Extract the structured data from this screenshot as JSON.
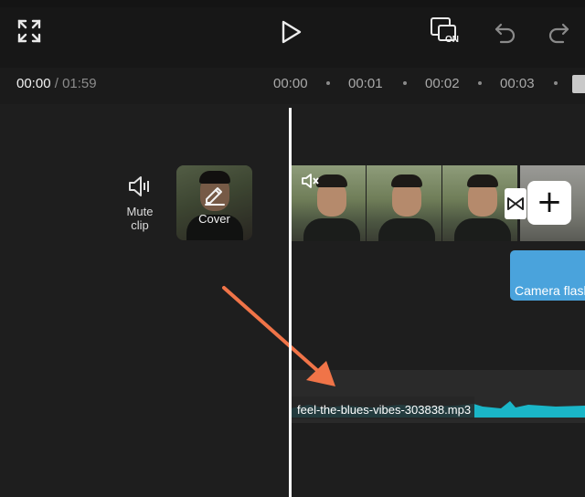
{
  "toolbar": {
    "fullscreen_icon": "expand-icon",
    "play_icon": "play-icon",
    "dual_view_icon": "preview-toggle-icon",
    "dual_view_badge": "ON",
    "undo_icon": "undo-icon",
    "redo_icon": "redo-icon"
  },
  "timecode": {
    "current": "00:00",
    "separator": "/",
    "total": "01:59"
  },
  "ruler": {
    "labels": [
      "00:00",
      "00:01",
      "00:02",
      "00:03"
    ]
  },
  "controls": {
    "mute_label_line1": "Mute",
    "mute_label_line2": "clip",
    "cover_label": "Cover"
  },
  "timeline": {
    "add_button_label": "+",
    "effect_clip_label": "Camera flash",
    "audio_clip_label": "feel-the-blues-vibes-303838.mp3"
  },
  "colors": {
    "background": "#1e1e1e",
    "effect_clip": "#4aa3dc",
    "waveform": "#1ab6c8",
    "annotation_arrow": "#f07448",
    "playhead": "#ffffff"
  }
}
